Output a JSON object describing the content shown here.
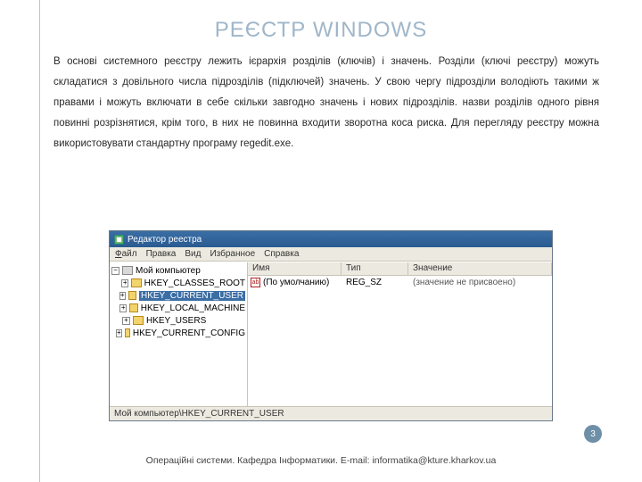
{
  "title": "РЕЄСТР WINDOWS",
  "body": "В основі системного реєстру лежить ієрархія розділів (ключів) і значень. Розділи (ключі реєстру) можуть складатися з довільного числа підрозділів (підключей) значень. У свою чергу підрозділи володіють такими ж правами і можуть включати в себе скільки завгодно значень і нових підрозділів. назви розділів одного рівня повинні розрізнятися, крім того, в них не повинна входити зворотна коса риска. Для перегляду реєстру можна використовувати стандартну програму regedit.exe.",
  "window": {
    "title": "Редактор реестра",
    "menu": {
      "file": "Файл",
      "edit": "Правка",
      "view": "Вид",
      "fav": "Избранное",
      "help": "Справка"
    },
    "tree": {
      "root": "Мой компьютер",
      "keys": [
        "HKEY_CLASSES_ROOT",
        "HKEY_CURRENT_USER",
        "HKEY_LOCAL_MACHINE",
        "HKEY_USERS",
        "HKEY_CURRENT_CONFIG"
      ],
      "selected_index": 1
    },
    "columns": {
      "name": "Имя",
      "type": "Тип",
      "value": "Значение"
    },
    "row": {
      "name": "(По умолчанию)",
      "type": "REG_SZ",
      "value": "(значение не присвоено)"
    },
    "status": "Мой компьютер\\HKEY_CURRENT_USER"
  },
  "page_number": "3",
  "footer": "Операційні системи. Кафедра Інформатики. E-mail: informatika@kture.kharkov.ua"
}
